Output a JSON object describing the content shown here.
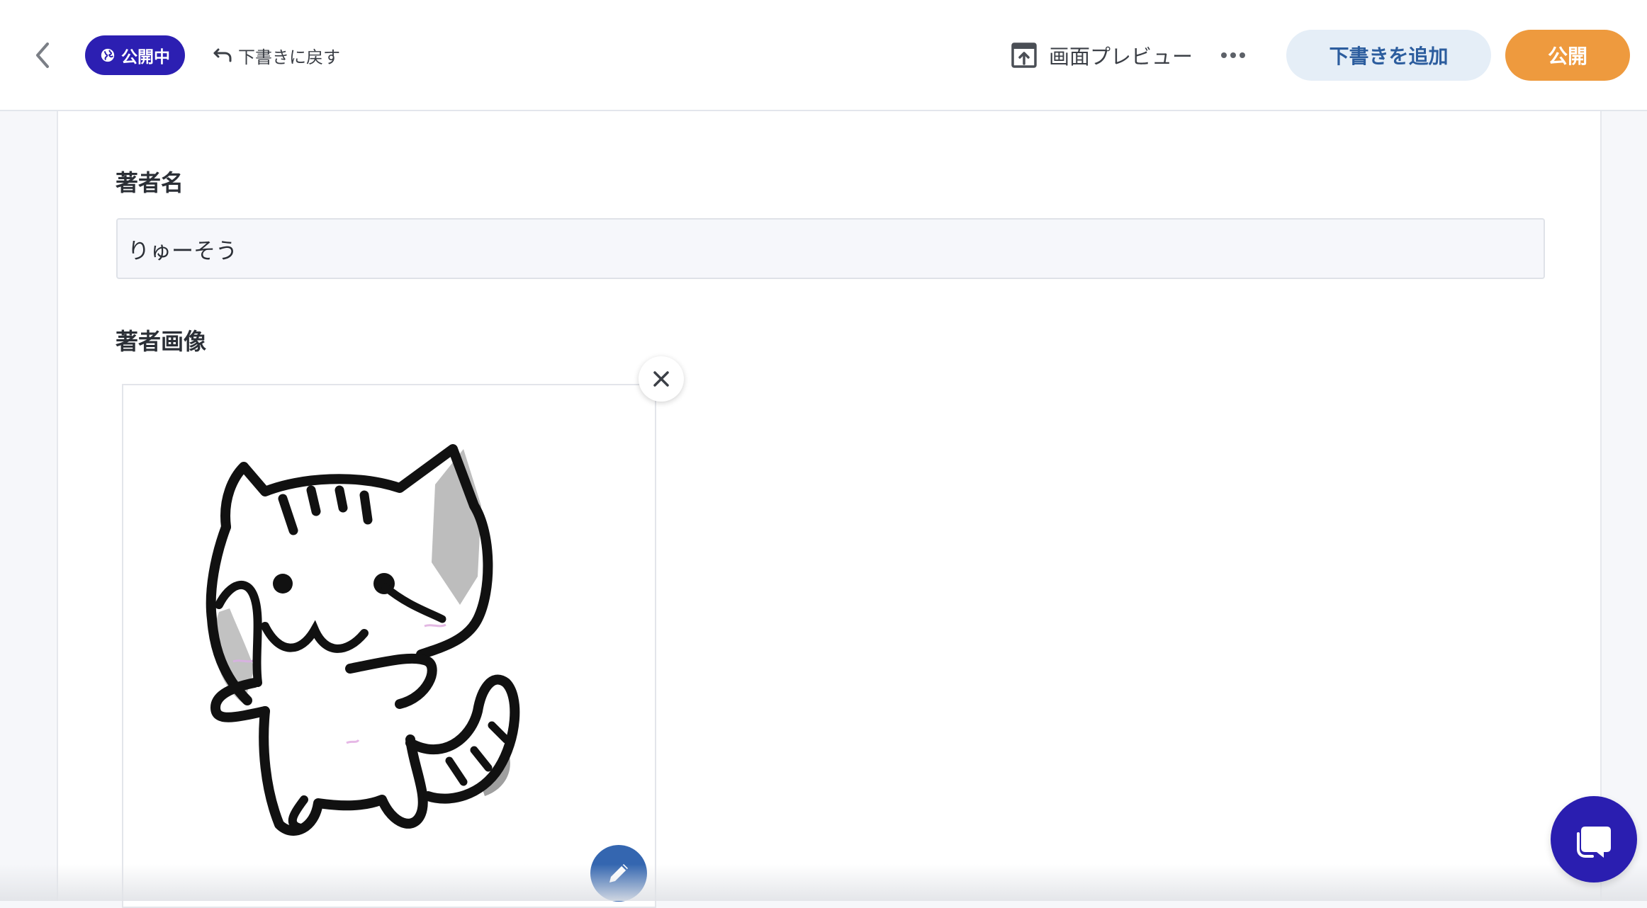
{
  "header": {
    "status_label": "公開中",
    "revert_label": "下書きに戻す",
    "preview_label": "画面プレビュー",
    "add_draft_label": "下書きを追加",
    "publish_label": "公開"
  },
  "form": {
    "author_name_label": "著者名",
    "author_name_value": "りゅーそう",
    "author_image_label": "著者画像"
  },
  "colors": {
    "status_pill": "#2c1fb2",
    "publish_button": "#ee9a3e",
    "draft_button_bg": "#e5eef7",
    "draft_button_text": "#2c5d9e",
    "edit_button": "#3466b0",
    "chat_button": "#2a1eb0"
  },
  "icons": {
    "back": "chevron-left-icon",
    "status": "globe-icon",
    "revert": "undo-icon",
    "preview": "open-preview-icon",
    "more": "more-dots-icon",
    "remove": "close-icon",
    "edit": "pencil-icon",
    "chat": "chat-bubble-icon"
  }
}
